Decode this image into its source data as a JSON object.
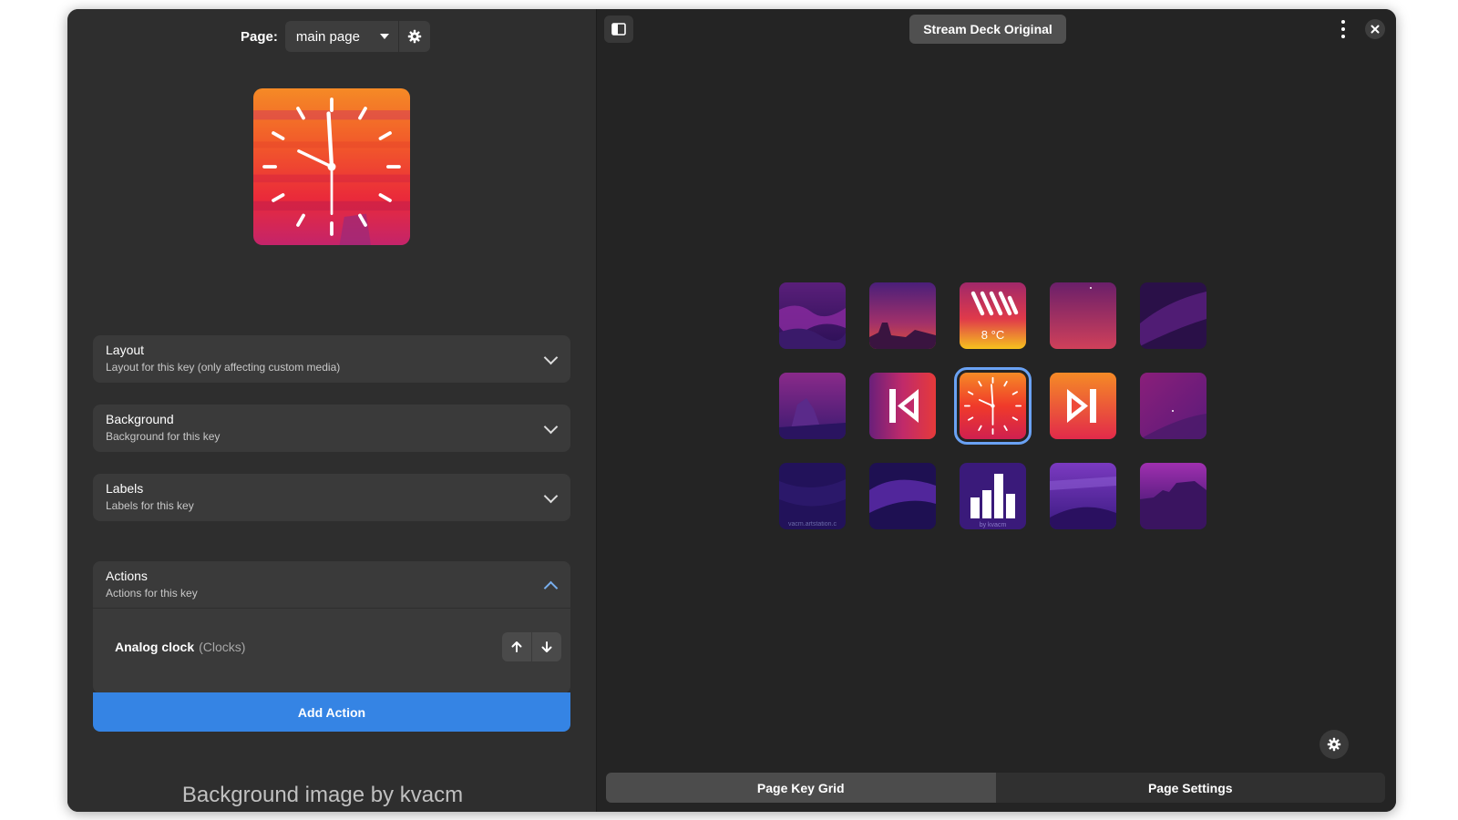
{
  "left_pane": {
    "page_label": "Page:",
    "page_value": "main page",
    "sections": [
      {
        "title": "Layout",
        "subtitle": "Layout for this key (only affecting custom media)"
      },
      {
        "title": "Background",
        "subtitle": "Background for this key"
      },
      {
        "title": "Labels",
        "subtitle": "Labels for this key"
      }
    ],
    "actions": {
      "title": "Actions",
      "subtitle": "Actions for this key",
      "items": [
        {
          "name": "Analog clock",
          "category": "(Clocks)"
        }
      ],
      "add_label": "Add Action"
    },
    "credit": "Background image by kvacm"
  },
  "header": {
    "deck_name": "Stream Deck Original"
  },
  "keys": [
    {
      "label": ""
    },
    {
      "label": ""
    },
    {
      "label": "8 °C"
    },
    {
      "label": ""
    },
    {
      "label": ""
    },
    {
      "label": ""
    },
    {
      "label": ""
    },
    {
      "label": ""
    },
    {
      "label": ""
    },
    {
      "label": ""
    },
    {
      "label": "vacm.artstation.c"
    },
    {
      "label": ""
    },
    {
      "label": "by kvacm"
    },
    {
      "label": ""
    },
    {
      "label": ""
    }
  ],
  "bottom_tabs": [
    "Page Key Grid",
    "Page Settings"
  ],
  "colors": {
    "accent": "#3584e4",
    "selection": "#6aa2f4"
  }
}
